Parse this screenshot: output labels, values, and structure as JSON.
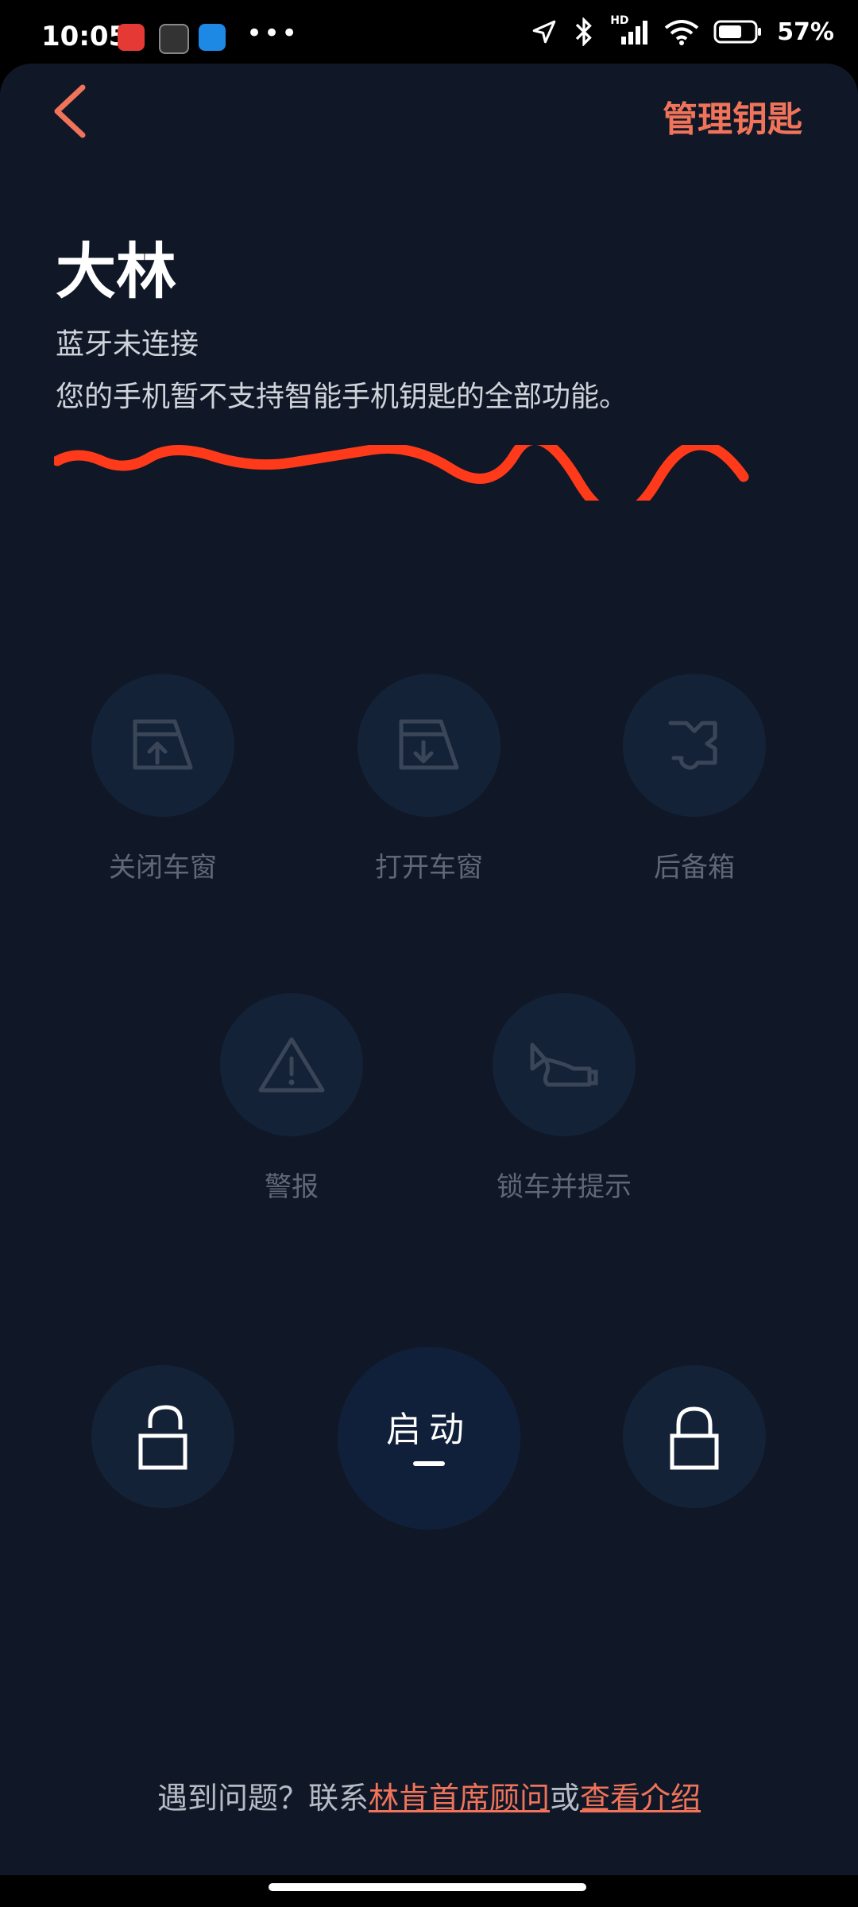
{
  "status_bar": {
    "time": "10:05",
    "more": "•••",
    "network": "HD",
    "battery": "57%"
  },
  "header": {
    "manage_keys": "管理钥匙"
  },
  "car": {
    "name": "大林",
    "bluetooth_status": "蓝牙未连接",
    "support_notice": "您的手机暂不支持智能手机钥匙的全部功能。"
  },
  "controls": {
    "close_window": "关闭车窗",
    "open_window": "打开车窗",
    "trunk": "后备箱",
    "alarm": "警报",
    "lock_and_alert": "锁车并提示"
  },
  "main_actions": {
    "start": "启动"
  },
  "footer": {
    "prefix": "遇到问题？联系",
    "advisor_link": "林肯首席顾问",
    "middle": "或",
    "intro_link": "查看介绍"
  },
  "colors": {
    "accent": "#f0735a",
    "background": "#101827",
    "button_bg": "#142238",
    "redaction": "#ff3a1a"
  }
}
